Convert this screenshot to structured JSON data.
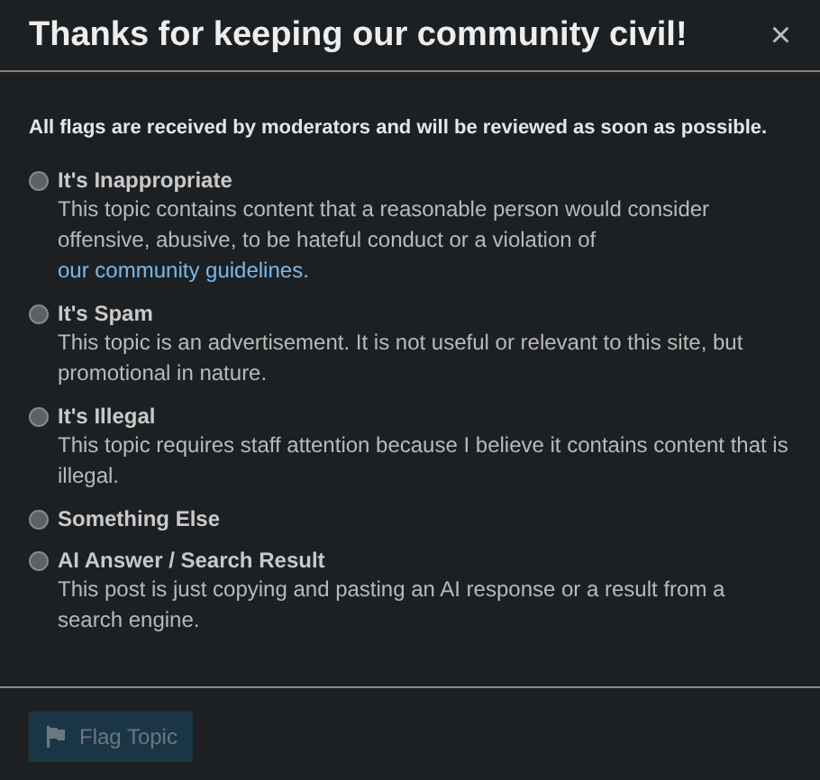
{
  "dialog": {
    "title": "Thanks for keeping our community civil!",
    "close": "×"
  },
  "intro": "All flags are received by moderators and will be reviewed as soon as possible.",
  "options": [
    {
      "label": "It's Inappropriate",
      "selected": false,
      "description": "This topic contains content that a reasonable person would consider offensive, abusive, to be hateful conduct or a violation of ",
      "link": "our community guidelines",
      "description_end": "."
    },
    {
      "label": "It's Spam",
      "selected": false,
      "description": "This topic is an advertisement. It is not useful or relevant to this site, but promotional in nature."
    },
    {
      "label": "It's Illegal",
      "selected": false,
      "description": "This topic requires staff attention because I believe it contains content that is illegal."
    },
    {
      "label": "Something Else",
      "selected": false
    },
    {
      "label": "AI Answer / Search Result",
      "selected": false,
      "description": "This post is just copying and pasting an AI response or a result from a search engine."
    }
  ],
  "button": {
    "label": "Flag Topic",
    "disabled": true
  }
}
